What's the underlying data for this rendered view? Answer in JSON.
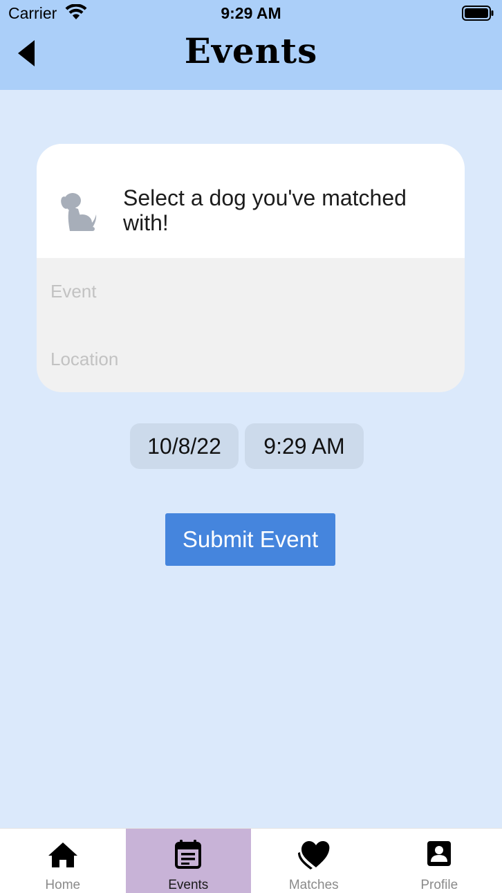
{
  "status_bar": {
    "carrier": "Carrier",
    "time": "9:29 AM"
  },
  "nav": {
    "title": "Events"
  },
  "form": {
    "dog_prompt": "Select a dog you've matched with!",
    "event_placeholder": "Event",
    "event_value": "",
    "location_placeholder": "Location",
    "location_value": "",
    "date": "10/8/22",
    "time": "9:29 AM",
    "submit_label": "Submit Event"
  },
  "tabs": [
    {
      "label": "Home",
      "icon": "home-icon",
      "active": false
    },
    {
      "label": "Events",
      "icon": "calendar-event-icon",
      "active": true
    },
    {
      "label": "Matches",
      "icon": "heart-icon",
      "active": false
    },
    {
      "label": "Profile",
      "icon": "profile-icon",
      "active": false
    }
  ],
  "colors": {
    "background": "#dbe9fb",
    "header": "#abcff9",
    "active_tab": "#c8b3d7",
    "submit_button": "#4585dd",
    "pill": "#ccdaeb"
  }
}
